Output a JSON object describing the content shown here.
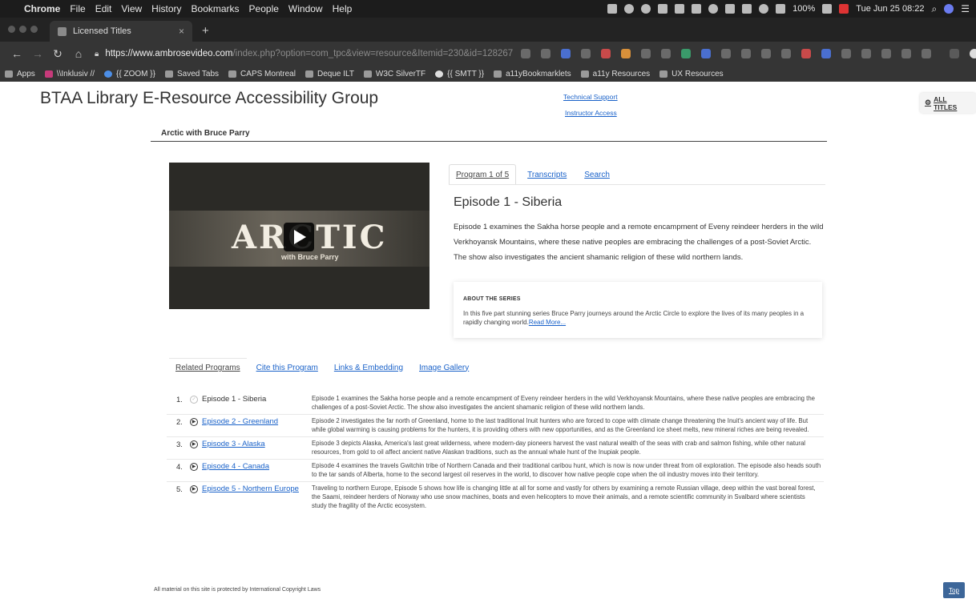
{
  "menubar": {
    "app": "Chrome",
    "items": [
      "File",
      "Edit",
      "View",
      "History",
      "Bookmarks",
      "People",
      "Window",
      "Help"
    ],
    "battery": "100%",
    "clock": "Tue Jun 25 08:22"
  },
  "tab": {
    "title": "Licensed Titles"
  },
  "toolbar": {
    "url_host": "https://www.ambrosevideo.com",
    "url_path": "/index.php?option=com_tpc&view=resource&Itemid=230&id=128267"
  },
  "bookmarks": [
    {
      "label": "Apps",
      "icon": "apps-grid-icon"
    },
    {
      "label": "\\\\Inklusiv //",
      "icon": "inklusiv-icon"
    },
    {
      "label": "{{ ZOOM }}",
      "icon": "zoom-icon"
    },
    {
      "label": "Saved Tabs",
      "icon": "folder-icon"
    },
    {
      "label": "CAPS Montreal",
      "icon": "folder-icon"
    },
    {
      "label": "Deque ILT",
      "icon": "folder-icon"
    },
    {
      "label": "W3C SilverTF",
      "icon": "folder-icon"
    },
    {
      "label": "{{ SMTT }}",
      "icon": "globe-icon"
    },
    {
      "label": "a11yBookmarklets",
      "icon": "folder-icon"
    },
    {
      "label": "a11y Resources",
      "icon": "folder-icon"
    },
    {
      "label": "UX Resources",
      "icon": "folder-icon"
    }
  ],
  "site": {
    "title": "BTAA Library E-Resource Accessibility Group",
    "tech_support": "Technical Support",
    "instructor_access": "Instructor Access",
    "all_titles": "ALL TITLES"
  },
  "program": {
    "title": "Arctic with Bruce Parry",
    "video_logo": "ARCTIC",
    "video_sub": "with Bruce Parry",
    "tabs": [
      "Program 1 of 5",
      "Transcripts",
      "Search"
    ],
    "episode_title": "Episode 1 - Siberia",
    "episode_desc": "Episode 1 examines the Sakha horse people and a remote encampment of Eveny reindeer herders in the wild Verkhoyansk Mountains, where these native peoples are embracing the challenges of a post-Soviet Arctic. The show also investigates the ancient shamanic religion of these wild northern lands.",
    "about_heading": "ABOUT THE SERIES",
    "about_text": "In this five part stunning series Bruce Parry journeys around the Arctic Circle to explore the lives of its many peoples in a rapidly changing world.",
    "read_more": "Read More..."
  },
  "lower_tabs": [
    "Related Programs",
    "Cite this Program",
    "Links & Embedding",
    "Image Gallery"
  ],
  "episodes": [
    {
      "num": "1.",
      "title": "Episode 1 - Siberia",
      "current": true,
      "desc": "Episode 1 examines the Sakha horse people and a remote encampment of Eveny reindeer herders in the wild Verkhoyansk Mountains, where these native peoples are embracing the challenges of a post-Soviet Arctic. The show also investigates the ancient shamanic religion of these wild northern lands."
    },
    {
      "num": "2.",
      "title": "Episode 2 - Greenland",
      "current": false,
      "desc": "Episode 2 investigates the far north of Greenland, home to the last traditional Inuit hunters who are forced to cope with climate change threatening the Inuit's ancient way of life. But while global warming is causing problems for the hunters, it is providing others with new opportunities, and as the Greenland ice sheet melts, new mineral riches are being revealed."
    },
    {
      "num": "3.",
      "title": "Episode 3 - Alaska",
      "current": false,
      "desc": "Episode 3 depicts Alaska, America's last great wilderness, where modern-day pioneers harvest the vast natural wealth of the seas with crab and salmon fishing, while other natural resources, from gold to oil affect ancient native Alaskan traditions, such as the annual whale hunt of the Inupiak people."
    },
    {
      "num": "4.",
      "title": "Episode 4 - Canada",
      "current": false,
      "desc": "Episode 4 examines the travels Gwitchin tribe of Northern Canada and their traditional caribou hunt, which is now is now under threat from oil exploration. The episode also heads south to the tar sands of Alberta, home to the second largest oil reserves in the world, to discover how native people cope when the oil industry moves into their territory."
    },
    {
      "num": "5.",
      "title": "Episode 5 - Northern Europe",
      "current": false,
      "desc": "Traveling to northern Europe, Episode 5 shows how life is changing little at all for some and vastly for others by examining a remote Russian village, deep within the vast boreal forest, the Saami, reindeer herders of Norway who use snow machines, boats and even helicopters to move their animals, and a remote scientific community in Svalbard where scientists study the fragility of the Arctic ecosystem."
    }
  ],
  "footer": {
    "text": "All material on this site is protected by International Copyright Laws",
    "top": "Top"
  }
}
